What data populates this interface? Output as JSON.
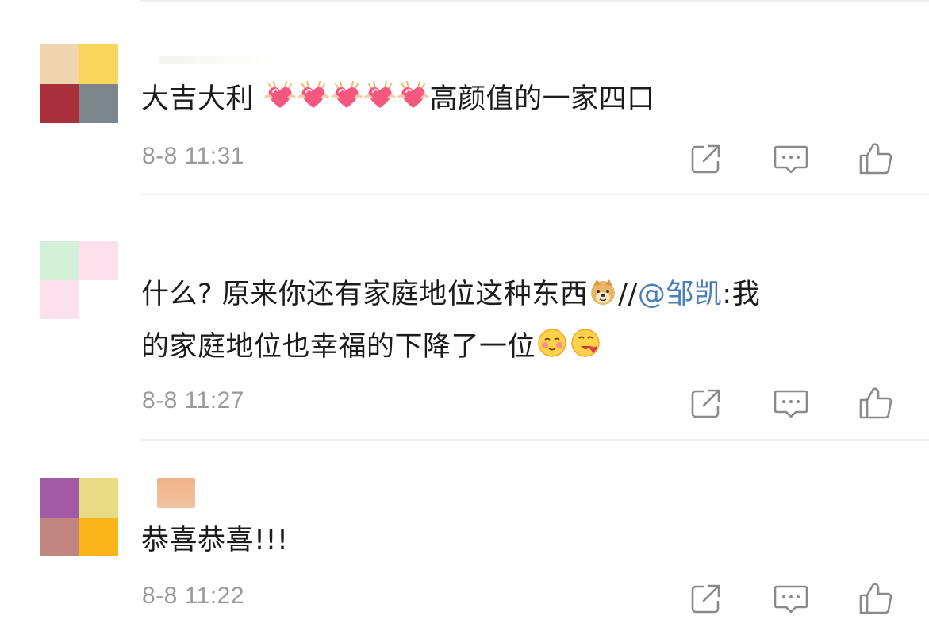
{
  "comments": [
    {
      "avatar_colors": [
        "#f0d5ae",
        "#f8d65c",
        "#a9303a",
        "#7d858c"
      ],
      "text_before_emoji": "大吉大利 ",
      "emoji_heart_count": 5,
      "text_after_emoji": "高颜值的一家四口",
      "time": "8-8 11:31"
    },
    {
      "avatar_colors": [
        "#d3f0d9",
        "#fde0ec",
        "#fce1ec",
        "#ffffff"
      ],
      "text_line1": "什么? 原来你还有家庭地位这种东西",
      "text_sep": "//",
      "mention": "@邹凯",
      "text_line1_end": ":我",
      "text_line2": "的家庭地位也幸福的下降了一位",
      "time": "8-8 11:27"
    },
    {
      "avatar_colors": [
        "#a35aa5",
        "#e7db84",
        "#c18680",
        "#fbb41a"
      ],
      "text": "恭喜恭喜!!!",
      "time": "8-8 11:22"
    }
  ],
  "icons": {
    "share": "share-icon",
    "reply": "comment-icon",
    "like": "thumbs-up-icon"
  },
  "colors": {
    "mention": "#4a7fb8",
    "timestamp": "#9a9a9a",
    "icon": "#8a8a8a"
  }
}
